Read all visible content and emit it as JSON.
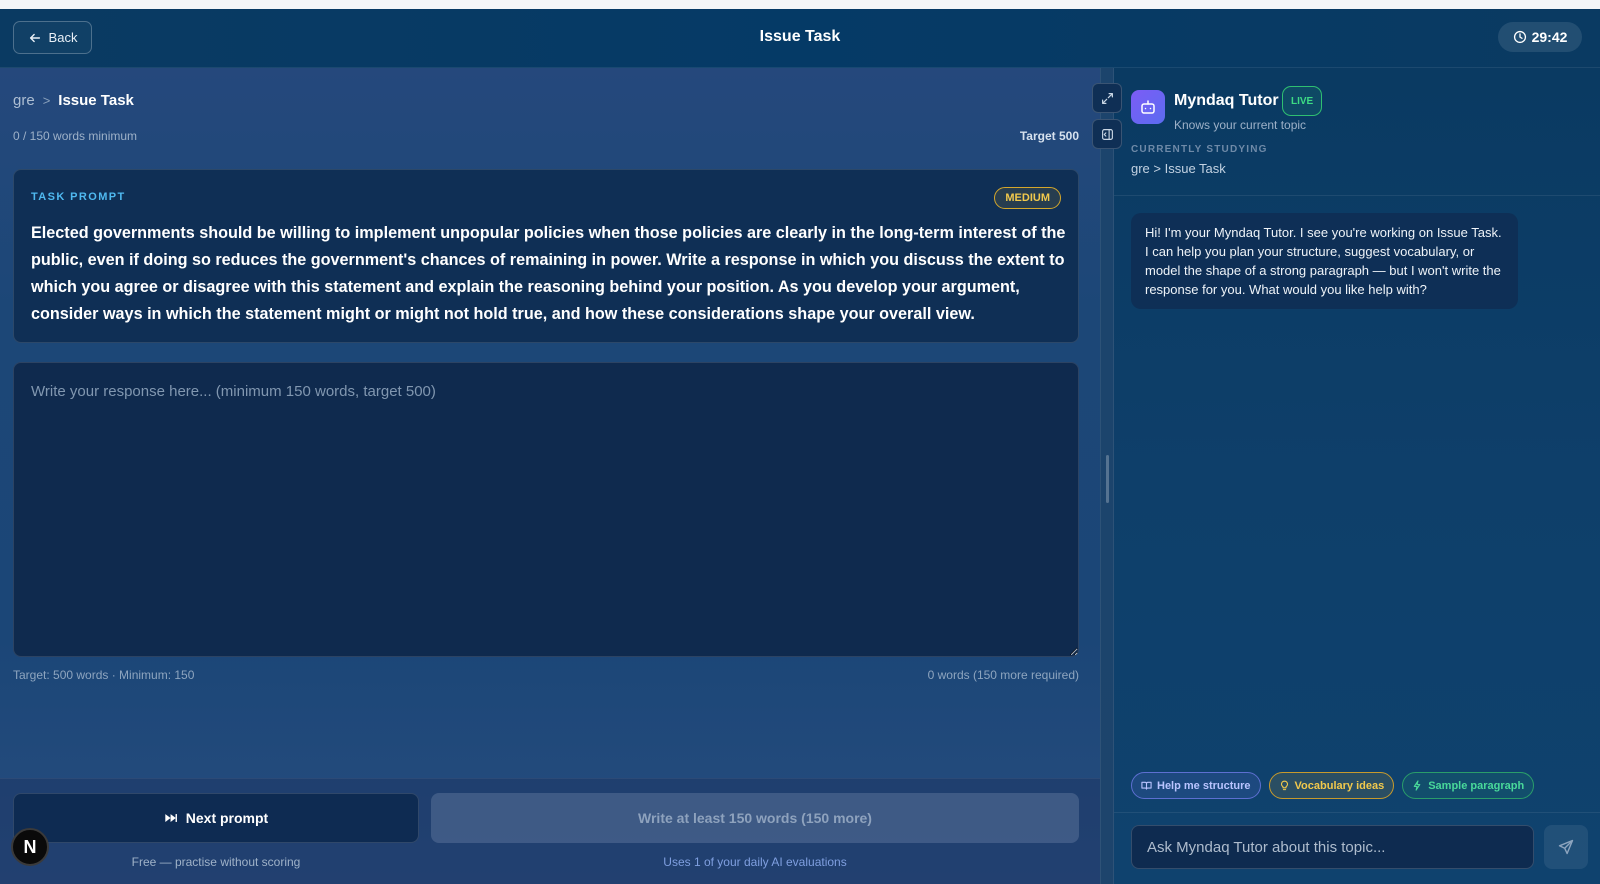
{
  "header": {
    "back_label": "Back",
    "title": "Issue Task",
    "timer": "29:42"
  },
  "editor_panel": {
    "breadcrumb": {
      "root": "gre",
      "separator": ">",
      "current": "Issue Task"
    },
    "word_status": "0 / 150 words minimum",
    "target_label": "Target 500",
    "prompt_card": {
      "label": "TASK PROMPT",
      "difficulty": "MEDIUM",
      "text": "Elected governments should be willing to implement unpopular policies when those policies are clearly in the long-term interest of the public, even if doing so reduces the government's chances of remaining in power. Write a response in which you discuss the extent to which you agree or disagree with this statement and explain the reasoning behind your position. As you develop your argument, consider ways in which the statement might or might not hold true, and how these considerations shape your overall view."
    },
    "response": {
      "value": "",
      "placeholder": "Write your response here... (minimum 150 words, target 500)"
    },
    "footnote_left": "Target: 500 words · Minimum: 150",
    "footnote_right": "0 words (150 more required)"
  },
  "actions": {
    "next_label": "Next prompt",
    "next_note": "Free — practise without scoring",
    "submit_label": "Write at least 150 words (150 more)",
    "submit_note": "Uses 1 of your daily AI evaluations"
  },
  "avatar_letter": "N",
  "tutor": {
    "name": "Myndaq Tutor",
    "status": "LIVE",
    "subtitle": "Knows your current topic",
    "studying_label": "CURRENTLY STUDYING",
    "studying_value": "gre > Issue Task",
    "messages": [
      {
        "role": "assistant",
        "text": "Hi! I'm your Myndaq Tutor. I see you're working on Issue Task. I can help you plan your structure, suggest vocabulary, or model the shape of a strong paragraph — but I won't write the response for you. What would you like help with?"
      }
    ],
    "chips": [
      {
        "label": "Help me structure",
        "icon": "book-icon"
      },
      {
        "label": "Vocabulary ideas",
        "icon": "lightbulb-icon"
      },
      {
        "label": "Sample paragraph",
        "icon": "sparkle-icon"
      }
    ],
    "input": {
      "value": "",
      "placeholder": "Ask Myndaq Tutor about this topic..."
    }
  },
  "icons": {
    "back": "arrow-left-icon",
    "timer": "clock-icon",
    "next": "skip-forward-icon",
    "expand": "expand-icon",
    "panel": "panel-toggle-icon",
    "bot": "bot-icon",
    "send": "send-icon"
  },
  "colors": {
    "accent_blue": "#4fb9f0",
    "medium_badge": "#f2c94c",
    "live_green": "#3ddc84",
    "bot_purple": "#7c5cf6"
  }
}
